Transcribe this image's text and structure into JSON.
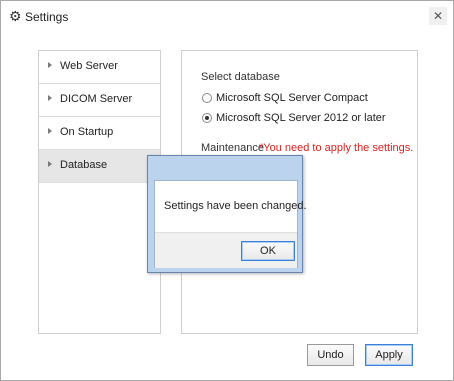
{
  "window": {
    "title": "Settings",
    "close_glyph": "✕"
  },
  "sidebar": {
    "items": [
      {
        "label": "Web Server",
        "active": false
      },
      {
        "label": "DICOM Server",
        "active": false
      },
      {
        "label": "On Startup",
        "active": false
      },
      {
        "label": "Database",
        "active": true
      }
    ]
  },
  "database": {
    "select_label": "Select database",
    "options": [
      {
        "label": "Microsoft SQL Server Compact",
        "selected": false
      },
      {
        "label": "Microsoft SQL Server 2012 or later",
        "selected": true
      }
    ],
    "maintenance_label": "Maintenance",
    "warning": "*You need to apply the settings.",
    "warning_color": "#e02020"
  },
  "footer": {
    "undo_label": "Undo",
    "apply_label": "Apply"
  },
  "dialog": {
    "message": "Settings have been changed.",
    "ok_label": "OK"
  },
  "colors": {
    "accent": "#3c7fd6",
    "dialog_frame": "#bcd3ee"
  },
  "icons": {
    "window_icon": "gear-icon"
  }
}
